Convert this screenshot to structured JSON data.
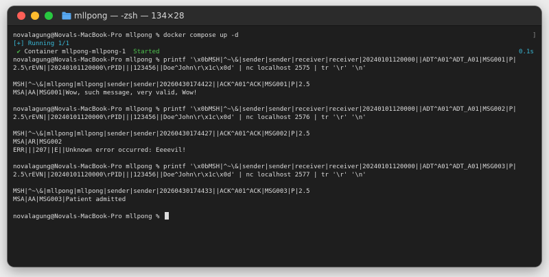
{
  "window": {
    "title": "mllpong — -zsh — 134×28"
  },
  "terminal": {
    "prompt": "novalagung@Novals-MacBook-Pro mllpong % ",
    "cmd_compose": "docker compose up -d",
    "bracket": "]",
    "running": "[+] Running 1/1",
    "check": "✔",
    "container": " Container mllpong-mllpong-1  ",
    "started": "Started",
    "duration": "0.1s",
    "cmd1a": "printf '\\x0bMSH|^~\\&|sender|sender|receiver|receiver|20240101120000||ADT^A01^ADT_A01|MSG001|P|",
    "cmd1b": "2.5\\rEVN||20240101120000\\rPID|||123456||Doe^John\\r\\x1c\\x0d' | nc localhost 2575 | tr '\\r' '\\n'",
    "resp1_msh": "MSH|^~\\&|mllpong|mllpong|sender|sender|20260430174422||ACK^A01^ACK|MSG001|P|2.5",
    "resp1_msa": "MSA|AA|MSG001|Wow, such message, very valid, Wow!",
    "cmd2a": "printf '\\x0bMSH|^~\\&|sender|sender|receiver|receiver|20240101120000||ADT^A01^ADT_A01|MSG002|P|",
    "cmd2b": "2.5\\rEVN||20240101120000\\rPID|||123456||Doe^John\\r\\x1c\\x0d' | nc localhost 2576 | tr '\\r' '\\n'",
    "resp2_msh": "MSH|^~\\&|mllpong|mllpong|sender|sender|20260430174427||ACK^A01^ACK|MSG002|P|2.5",
    "resp2_msa": "MSA|AR|MSG002",
    "resp2_err": "ERR|||207||E||Unknown error occurred: Eeeevil!",
    "cmd3a": "printf '\\x0bMSH|^~\\&|sender|sender|receiver|receiver|20240101120000||ADT^A01^ADT_A01|MSG003|P|",
    "cmd3b": "2.5\\rEVN||20240101120000\\rPID|||123456||Doe^John\\r\\x1c\\x0d' | nc localhost 2577 | tr '\\r' '\\n'",
    "resp3_msh": "MSH|^~\\&|mllpong|mllpong|sender|sender|20260430174433||ACK^A01^ACK|MSG003|P|2.5",
    "resp3_msa": "MSA|AA|MSG003|Patient admitted"
  },
  "colors": {
    "close": "#fe5f57",
    "minimize": "#febc2e",
    "zoom": "#28c840",
    "running": "#39b8d6",
    "started": "#4ec24e",
    "folder": "#5aa9f0"
  },
  "icons": {
    "folder": "folder-icon",
    "check": "checkmark-icon"
  }
}
